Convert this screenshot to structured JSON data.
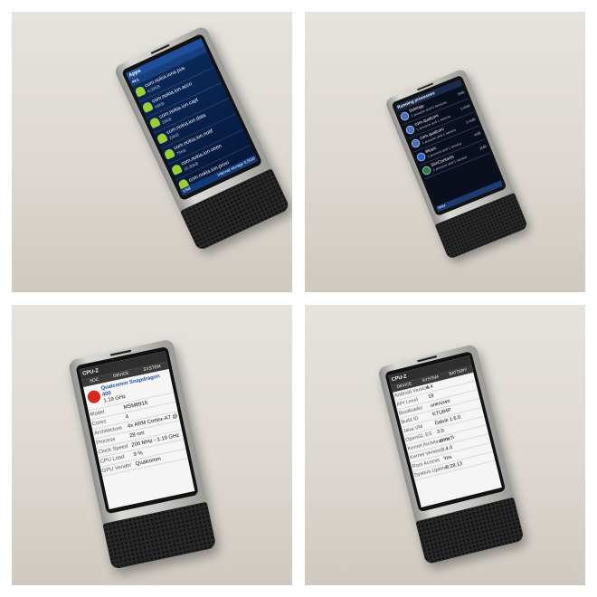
{
  "colors": {
    "apps_bg": "#0b2a5c",
    "cpuz_bg": "#f5f5f5",
    "android_green": "#9ccc36",
    "qualcomm_red": "#d52b1e"
  },
  "photo1": {
    "title": "Apps",
    "tab": "ALL",
    "rows": [
      {
        "name": "com.nokia.iona.pus",
        "size": "4.00KB"
      },
      {
        "name": "com.nokia.ion.acco",
        "size": "44KB"
      },
      {
        "name": "com.nokia.ion.capt",
        "size": "28KB"
      },
      {
        "name": "com.nokia.ion.data",
        "size": "24KB"
      },
      {
        "name": "com.nokia.ion.notif",
        "size": "75KB"
      },
      {
        "name": "com.nokia.ion.onen",
        "size": "16.00KB"
      },
      {
        "name": "com.nokia.ion.provi",
        "size": ""
      }
    ],
    "footer_left": "USB",
    "footer_right": "Internal storage  8.5GB"
  },
  "photo2": {
    "title": "Running processes",
    "rows": [
      {
        "name": "Settings",
        "sub": "1 process and 0 services",
        "size": "5MB"
      },
      {
        "name": "com.qualcom",
        "sub": "1 process and 1 service",
        "size": "3.4MB"
      },
      {
        "name": "com.qualcom",
        "sub": "1 process and 1 service",
        "size": "3.4MB"
      },
      {
        "name": "Music",
        "sub": "1 process and 1 service",
        "size": "4MB"
      },
      {
        "name": "SimContacts",
        "sub": "1 process and 1 service",
        "size": "3MB"
      }
    ],
    "footer": "RAM"
  },
  "photo3": {
    "app": "CPU-Z",
    "tabs": [
      "SOC",
      "DEVICE",
      "SYSTEM"
    ],
    "soc_name": "Qualcomm Snapdragon 400",
    "soc_freq": "1.19 GHz",
    "rows": [
      {
        "k": "Model",
        "v": "MSM8916"
      },
      {
        "k": "Cores",
        "v": "4"
      },
      {
        "k": "Architecture",
        "v": "4x ARM Cortex-A7 @ 1.19 GHz"
      },
      {
        "k": "Process",
        "v": "28 nm"
      },
      {
        "k": "Clock Speed",
        "v": "200 MHz - 1.19 GHz"
      },
      {
        "k": "CPU Load",
        "v": "9 %"
      },
      {
        "k": "GPU Vendor",
        "v": "Qualcomm"
      }
    ]
  },
  "photo4": {
    "app": "CPU-Z",
    "tabs": [
      "DEVICE",
      "SYSTEM",
      "BATTERY"
    ],
    "rows": [
      {
        "k": "Android Version",
        "v": "4.4"
      },
      {
        "k": "API Level",
        "v": "19"
      },
      {
        "k": "Bootloader",
        "v": "unknown"
      },
      {
        "k": "Build ID",
        "v": "KTU84P"
      },
      {
        "k": "Java VM",
        "v": "Dalvik 1.6.0"
      },
      {
        "k": "OpenGL ES",
        "v": "3.0"
      },
      {
        "k": "Kernel Architecture",
        "v": "armv7l"
      },
      {
        "k": "Kernel Version",
        "v": "3.4.0"
      },
      {
        "k": "Root Access",
        "v": "Yes"
      },
      {
        "k": "System Uptime",
        "v": "0:28:13"
      }
    ]
  }
}
